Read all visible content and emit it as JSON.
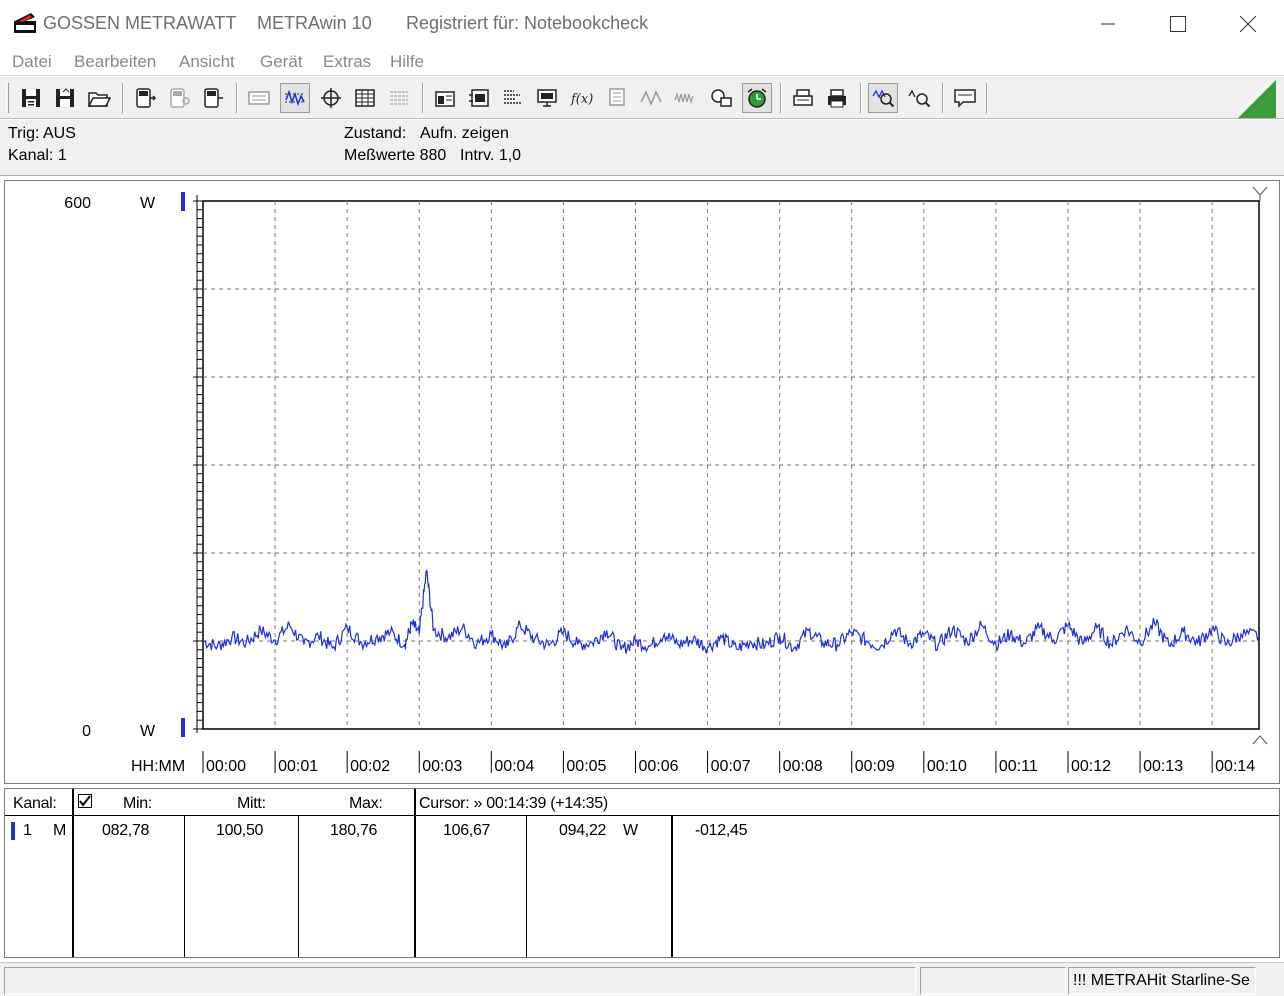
{
  "window": {
    "brand": "GOSSEN METRAWATT",
    "app_name": "METRAwin 10",
    "registered": "Registriert für: Notebookcheck",
    "minimize_icon": "minimize-icon",
    "maximize_icon": "maximize-icon",
    "close_icon": "close-icon"
  },
  "menu": {
    "items": [
      "Datei",
      "Bearbeiten",
      "Ansicht",
      "Gerät",
      "Extras",
      "Hilfe"
    ]
  },
  "toolbar": {
    "icons": [
      "save-icon",
      "save-as-icon",
      "open-folder-icon",
      "device-read-icon",
      "device-config-icon",
      "device-send-icon",
      "keyboard-icon",
      "wave-display-icon",
      "crosshair-icon",
      "table-icon",
      "list-icon",
      "scale-icon",
      "channel-icon",
      "measure-list-icon",
      "monitor-icon",
      "function-icon",
      "memory-icon",
      "triangle-wave-icon",
      "noise-wave-icon",
      "print-setup-icon",
      "alarm-clock-icon",
      "print-icon",
      "printer-icon",
      "zoom-in-icon",
      "zoom-out-icon",
      "comment-icon"
    ]
  },
  "info": {
    "trig": "Trig: AUS",
    "kanal": "Kanal: 1",
    "zustand_label": "Zustand:",
    "zustand_value": "Aufn. zeigen",
    "messwerte": "Meßwerte 880",
    "intervall": "Intrv. 1,0"
  },
  "chart_data": {
    "type": "line",
    "y_max_label": "600",
    "y_min_label": "0",
    "y_unit_top": "W",
    "y_unit_bottom": "W",
    "ylim": [
      0,
      600
    ],
    "x_axis_label": "HH:MM",
    "x_ticks": [
      "00:00",
      "00:01",
      "00:02",
      "00:03",
      "00:04",
      "00:05",
      "00:06",
      "00:07",
      "00:08",
      "00:09",
      "00:10",
      "00:11",
      "00:12",
      "00:13",
      "00:14"
    ],
    "xlim_minutes": [
      0,
      14.65
    ],
    "grid": true,
    "series": [
      {
        "color": "#1f2fd6",
        "minutes": [
          0.0,
          0.2,
          0.4,
          0.6,
          0.8,
          1.0,
          1.2,
          1.4,
          1.6,
          1.8,
          2.0,
          2.2,
          2.4,
          2.6,
          2.8,
          2.9,
          3.0,
          3.1,
          3.2,
          3.4,
          3.6,
          3.8,
          4.0,
          4.2,
          4.4,
          4.6,
          4.8,
          5.0,
          5.2,
          5.4,
          5.6,
          5.8,
          6.0,
          6.2,
          6.4,
          6.6,
          6.8,
          7.0,
          7.2,
          7.4,
          7.6,
          7.8,
          8.0,
          8.2,
          8.4,
          8.6,
          8.8,
          9.0,
          9.2,
          9.4,
          9.6,
          9.8,
          10.0,
          10.2,
          10.4,
          10.6,
          10.8,
          11.0,
          11.2,
          11.4,
          11.6,
          11.8,
          12.0,
          12.2,
          12.4,
          12.6,
          12.8,
          13.0,
          13.2,
          13.4,
          13.6,
          13.8,
          14.0,
          14.2,
          14.4,
          14.65
        ],
        "values": [
          100,
          94,
          104,
          98,
          112,
          101,
          118,
          96,
          106,
          92,
          115,
          98,
          104,
          110,
          96,
          120,
          108,
          180,
          112,
          104,
          115,
          97,
          108,
          92,
          118,
          102,
          95,
          110,
          96,
          98,
          112,
          90,
          100,
          94,
          108,
          96,
          102,
          93,
          104,
          91,
          99,
          95,
          106,
          92,
          112,
          98,
          96,
          110,
          100,
          94,
          113,
          97,
          108,
          95,
          114,
          99,
          118,
          96,
          108,
          97,
          115,
          101,
          118,
          97,
          115,
          96,
          114,
          99,
          120,
          95,
          110,
          98,
          114,
          96,
          108,
          106
        ]
      }
    ]
  },
  "table": {
    "h_kanal": "Kanal:",
    "h_min": "Min:",
    "h_mitt": "Mitt:",
    "h_max": "Max:",
    "h_cursor": "Cursor: » 00:14:39 (+14:35)",
    "row": {
      "channel": "1",
      "mode": "M",
      "min": "082,78",
      "mitt": "100,50",
      "max": "180,76",
      "cursor_a": "106,67",
      "cursor_b": "094,22",
      "unit": "W",
      "diff": "-012,45"
    }
  },
  "statusbar": {
    "device": "!!! METRAHit Starline-Se"
  }
}
